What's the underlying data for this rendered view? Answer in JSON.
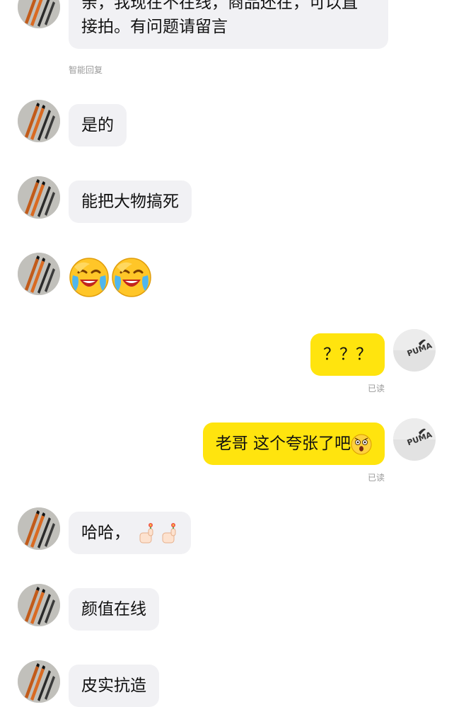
{
  "messages": [
    {
      "side": "left",
      "text": "亲，我现在不在线，商品还在，可以直\n接拍。有问题请留言",
      "label": "智能回复"
    },
    {
      "side": "left",
      "text": "是的"
    },
    {
      "side": "left",
      "text": "能把大物搞死"
    },
    {
      "side": "left",
      "emoji": [
        "crying-laughing-emoji",
        "crying-laughing-emoji"
      ]
    },
    {
      "side": "right",
      "text": "？？？",
      "status": "已读"
    },
    {
      "side": "right",
      "text": "老哥 这个夸张了吧",
      "emoji_after": "astonished-emoji",
      "status": "已读"
    },
    {
      "side": "left",
      "text": "哈哈，",
      "emoji_after": [
        "flower-thumb-emoji",
        "flower-thumb-emoji"
      ]
    },
    {
      "side": "left",
      "text": "颜值在线"
    },
    {
      "side": "left",
      "text": "皮实抗造"
    }
  ],
  "m0": {
    "line1": "亲，我现在不在线，商品还在，可以直",
    "line2": "接拍。有问题请留言",
    "label": "智能回复"
  },
  "m1": {
    "text": "是的"
  },
  "m2": {
    "text": "能把大物搞死"
  },
  "m4": {
    "text": "？？？",
    "status": "已读"
  },
  "m5": {
    "text": "老哥 这个夸张了吧",
    "status": "已读"
  },
  "m6": {
    "text": "哈哈，"
  },
  "m7": {
    "text": "颜值在线"
  },
  "m8": {
    "text": "皮实抗造"
  },
  "colors": {
    "incoming_bubble": "#f1f1f4",
    "outgoing_bubble": "#ffe40e",
    "meta_text": "#9a9a9a"
  },
  "avatars": {
    "seller": "pens-photo-avatar",
    "buyer": "puma-logo-avatar"
  }
}
